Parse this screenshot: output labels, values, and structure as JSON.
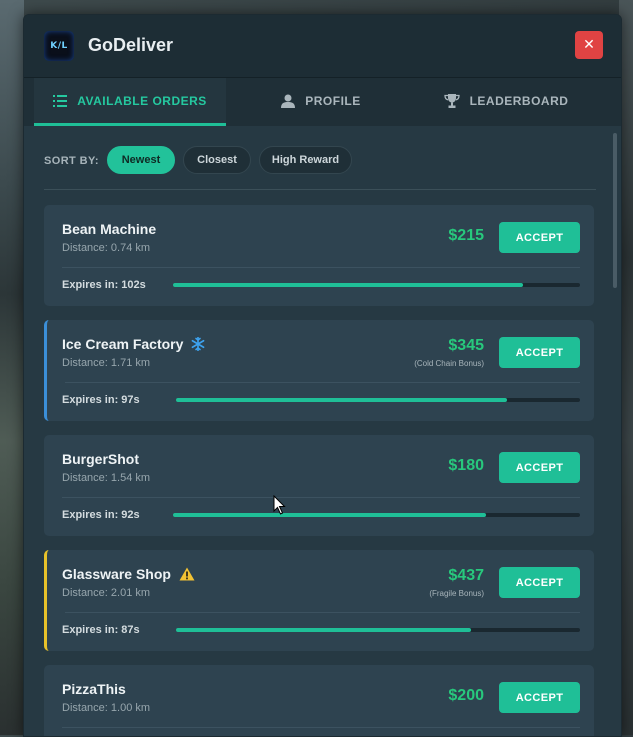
{
  "app": {
    "title": "GoDeliver",
    "logo_text": "K/L"
  },
  "header": {
    "close_label": "✕"
  },
  "tabs": [
    {
      "label": "AVAILABLE ORDERS",
      "icon": "list-icon",
      "active": true
    },
    {
      "label": "PROFILE",
      "icon": "user-icon",
      "active": false
    },
    {
      "label": "LEADERBOARD",
      "icon": "trophy-icon",
      "active": false
    }
  ],
  "sort": {
    "label": "SORT BY:",
    "options": [
      {
        "label": "Newest",
        "active": true
      },
      {
        "label": "Closest",
        "active": false
      },
      {
        "label": "High Reward",
        "active": false
      }
    ]
  },
  "orders": [
    {
      "name": "Bean Machine",
      "distance": "Distance: 0.74 km",
      "reward": "$215",
      "bonus": "",
      "accept": "ACCEPT",
      "expires": "Expires in: 102s",
      "progress": 0.86,
      "type": "normal"
    },
    {
      "name": "Ice Cream Factory",
      "distance": "Distance: 1.71 km",
      "reward": "$345",
      "bonus": "(Cold Chain Bonus)",
      "accept": "ACCEPT",
      "expires": "Expires in: 97s",
      "progress": 0.82,
      "type": "cold"
    },
    {
      "name": "BurgerShot",
      "distance": "Distance: 1.54 km",
      "reward": "$180",
      "bonus": "",
      "accept": "ACCEPT",
      "expires": "Expires in: 92s",
      "progress": 0.77,
      "type": "normal"
    },
    {
      "name": "Glassware Shop",
      "distance": "Distance: 2.01 km",
      "reward": "$437",
      "bonus": "(Fragile Bonus)",
      "accept": "ACCEPT",
      "expires": "Expires in: 87s",
      "progress": 0.73,
      "type": "fragile"
    },
    {
      "name": "PizzaThis",
      "distance": "Distance: 1.00 km",
      "reward": "$200",
      "bonus": "",
      "accept": "ACCEPT",
      "expires": "",
      "progress": null,
      "type": "normal"
    }
  ],
  "colors": {
    "accent": "#1fbf97",
    "reward": "#27c97d",
    "close": "#e04343",
    "cold": "#3b8fd8",
    "fragile": "#e8c22a"
  }
}
